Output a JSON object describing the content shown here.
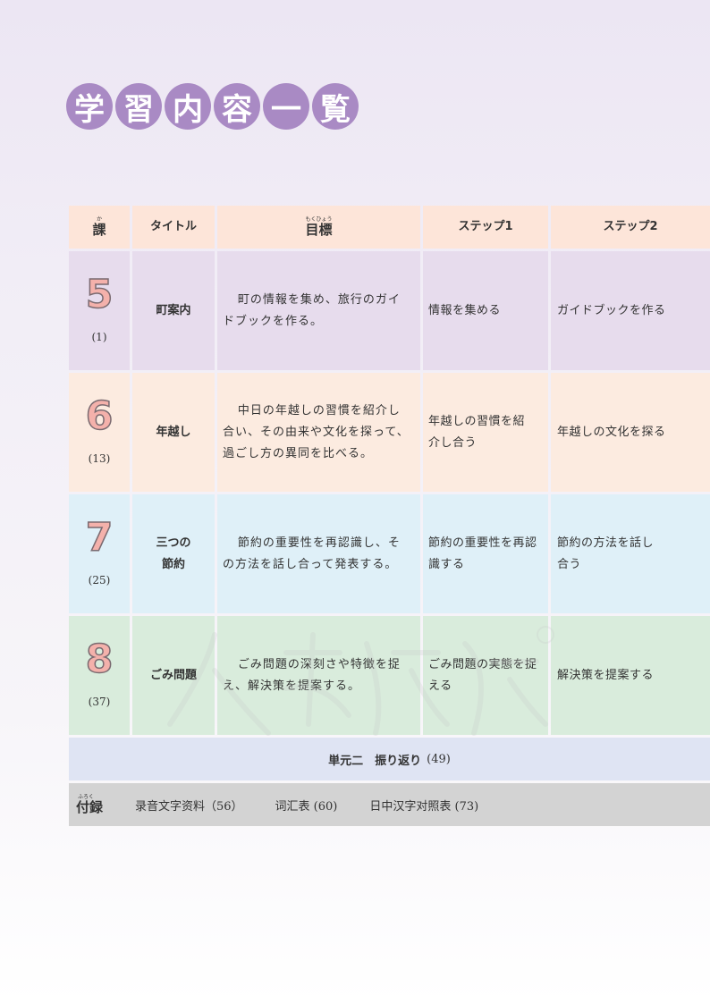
{
  "title": [
    "学",
    "習",
    "内",
    "容",
    "一",
    "覧"
  ],
  "header": {
    "lesson_ruby": "か",
    "lesson": "課",
    "title": "タイトル",
    "goal_ruby": "もくひょう",
    "goal": "目標",
    "step1": "ステップ1",
    "step2": "ステップ2"
  },
  "rows": [
    {
      "num": "5",
      "page": "(1)",
      "bg": "#e7dced",
      "title": [
        "町案内"
      ],
      "goal": [
        "町の情報を集め、旅行のガイ",
        "ドブックを作る。"
      ],
      "step1": [
        "情報を集める"
      ],
      "step2": [
        "ガイドブックを作る"
      ]
    },
    {
      "num": "6",
      "page": "(13)",
      "bg": "#fcebe0",
      "title": [
        "年越し"
      ],
      "goal": [
        "中日の年越しの習慣を紹介し",
        "合い、その由来や文化を探って、",
        "過ごし方の異同を比べる。"
      ],
      "step1": [
        "年越しの習慣を紹",
        "介し合う"
      ],
      "step2": [
        "年越しの文化を探る"
      ]
    },
    {
      "num": "7",
      "page": "(25)",
      "bg": "#dff0f8",
      "title": [
        "三つの",
        "節約"
      ],
      "goal": [
        "節約の重要性を再認識し、そ",
        "の方法を話し合って発表する。"
      ],
      "step1": [
        "節約の重要性を再認",
        "識する"
      ],
      "step2": [
        "節約の方法を話し",
        "合う"
      ]
    },
    {
      "num": "8",
      "page": "(37)",
      "bg": "#d9ecdc",
      "title": [
        "ごみ問題"
      ],
      "goal": [
        "ごみ問題の深刻さや特徴を捉",
        "え、解決策を提案する。"
      ],
      "step1": [
        "ごみ問題の実態を捉",
        "える"
      ],
      "step2": [
        "解決策を提案する"
      ]
    }
  ],
  "review": {
    "label": "単元二　振り返り",
    "page": "(49)"
  },
  "appendix": {
    "ruby": "ふろく",
    "label": "付録",
    "items": [
      "录音文字资料（56）",
      "词汇表 (60)",
      "日中汉字对照表 (73)"
    ]
  },
  "colors": {
    "title_circle": "#a98ac4",
    "header_bg": "#fde5d9",
    "number_fill": "#f4b1ab",
    "review_bg": "#dfe4f3",
    "appendix_bg": "#d3d3d3"
  }
}
